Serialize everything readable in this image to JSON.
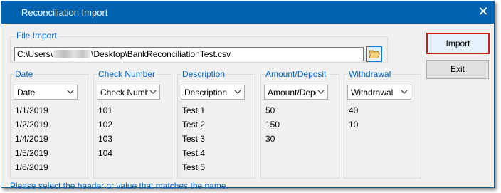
{
  "window": {
    "title": "Reconciliation Import",
    "close_glyph": "✕"
  },
  "file_import": {
    "label": "File Import",
    "path_prefix": "C:\\Users\\",
    "path_suffix": "\\Desktop\\BankReconciliationTest.csv",
    "browse_icon": "folder-open-icon"
  },
  "columns": [
    {
      "label": "Date",
      "dropdown": "Date",
      "values": [
        "1/1/2019",
        "1/2/2019",
        "1/4/2019",
        "1/5/2019",
        "1/6/2019"
      ]
    },
    {
      "label": "Check Number",
      "dropdown": "Check Numbe",
      "values": [
        "101",
        "102",
        "103",
        "104"
      ]
    },
    {
      "label": "Description",
      "dropdown": "Description",
      "values": [
        "Test 1",
        "Test 2",
        "Test 3",
        "Test 4",
        "Test 5"
      ]
    },
    {
      "label": "Amount/Deposit",
      "dropdown": "Amount/Depc",
      "values": [
        "50",
        "150",
        "30"
      ]
    },
    {
      "label": "Withdrawal",
      "dropdown": "Withdrawal",
      "values": [
        "40",
        "10"
      ]
    }
  ],
  "buttons": {
    "import": "Import",
    "exit": "Exit"
  },
  "status": "Please select the header or value that matches the name.",
  "colors": {
    "titlebar": "#0063b1",
    "accent": "#0066cc",
    "highlight_border": "#d11a1a"
  }
}
